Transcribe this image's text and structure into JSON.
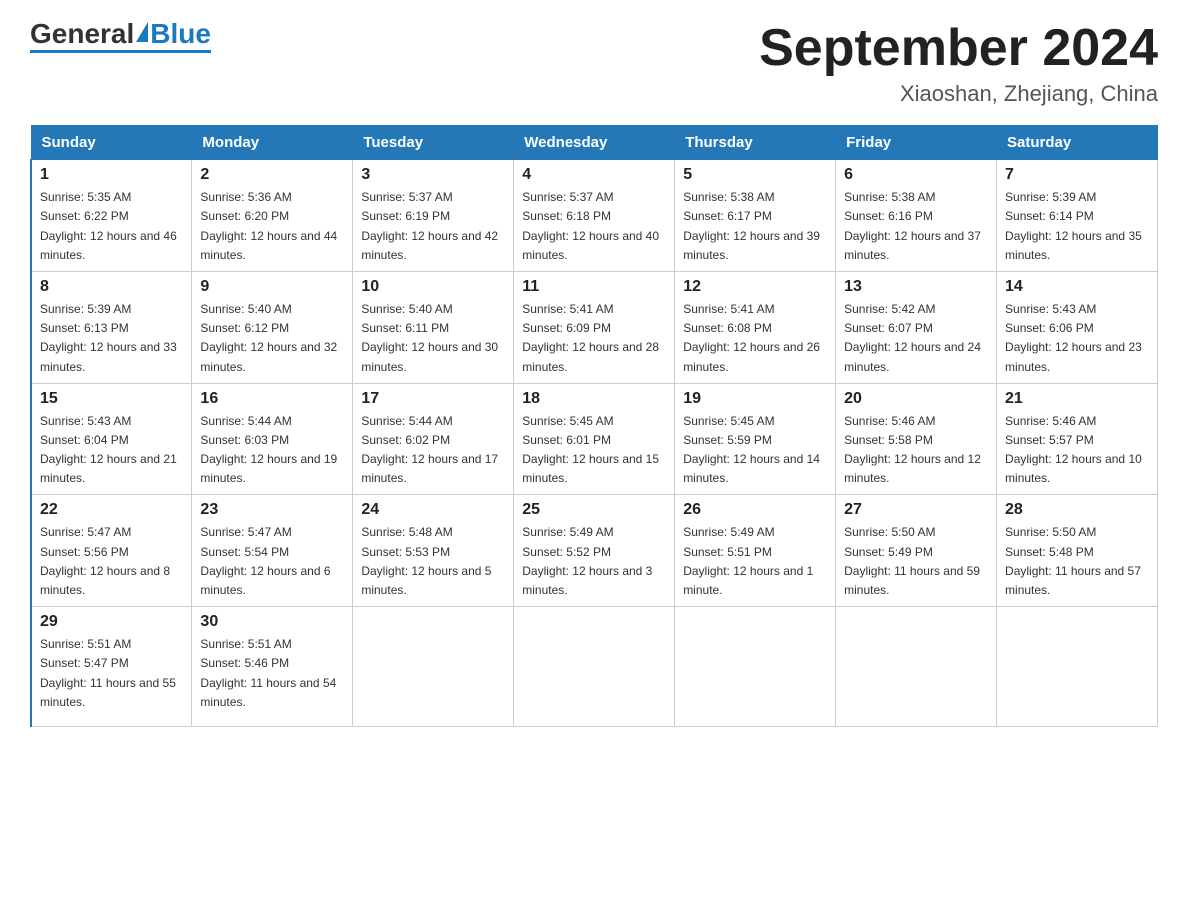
{
  "header": {
    "logo_general": "General",
    "logo_blue": "Blue",
    "month_title": "September 2024",
    "location": "Xiaoshan, Zhejiang, China"
  },
  "days_of_week": [
    "Sunday",
    "Monday",
    "Tuesday",
    "Wednesday",
    "Thursday",
    "Friday",
    "Saturday"
  ],
  "weeks": [
    [
      {
        "day": "1",
        "sunrise": "5:35 AM",
        "sunset": "6:22 PM",
        "daylight": "12 hours and 46 minutes."
      },
      {
        "day": "2",
        "sunrise": "5:36 AM",
        "sunset": "6:20 PM",
        "daylight": "12 hours and 44 minutes."
      },
      {
        "day": "3",
        "sunrise": "5:37 AM",
        "sunset": "6:19 PM",
        "daylight": "12 hours and 42 minutes."
      },
      {
        "day": "4",
        "sunrise": "5:37 AM",
        "sunset": "6:18 PM",
        "daylight": "12 hours and 40 minutes."
      },
      {
        "day": "5",
        "sunrise": "5:38 AM",
        "sunset": "6:17 PM",
        "daylight": "12 hours and 39 minutes."
      },
      {
        "day": "6",
        "sunrise": "5:38 AM",
        "sunset": "6:16 PM",
        "daylight": "12 hours and 37 minutes."
      },
      {
        "day": "7",
        "sunrise": "5:39 AM",
        "sunset": "6:14 PM",
        "daylight": "12 hours and 35 minutes."
      }
    ],
    [
      {
        "day": "8",
        "sunrise": "5:39 AM",
        "sunset": "6:13 PM",
        "daylight": "12 hours and 33 minutes."
      },
      {
        "day": "9",
        "sunrise": "5:40 AM",
        "sunset": "6:12 PM",
        "daylight": "12 hours and 32 minutes."
      },
      {
        "day": "10",
        "sunrise": "5:40 AM",
        "sunset": "6:11 PM",
        "daylight": "12 hours and 30 minutes."
      },
      {
        "day": "11",
        "sunrise": "5:41 AM",
        "sunset": "6:09 PM",
        "daylight": "12 hours and 28 minutes."
      },
      {
        "day": "12",
        "sunrise": "5:41 AM",
        "sunset": "6:08 PM",
        "daylight": "12 hours and 26 minutes."
      },
      {
        "day": "13",
        "sunrise": "5:42 AM",
        "sunset": "6:07 PM",
        "daylight": "12 hours and 24 minutes."
      },
      {
        "day": "14",
        "sunrise": "5:43 AM",
        "sunset": "6:06 PM",
        "daylight": "12 hours and 23 minutes."
      }
    ],
    [
      {
        "day": "15",
        "sunrise": "5:43 AM",
        "sunset": "6:04 PM",
        "daylight": "12 hours and 21 minutes."
      },
      {
        "day": "16",
        "sunrise": "5:44 AM",
        "sunset": "6:03 PM",
        "daylight": "12 hours and 19 minutes."
      },
      {
        "day": "17",
        "sunrise": "5:44 AM",
        "sunset": "6:02 PM",
        "daylight": "12 hours and 17 minutes."
      },
      {
        "day": "18",
        "sunrise": "5:45 AM",
        "sunset": "6:01 PM",
        "daylight": "12 hours and 15 minutes."
      },
      {
        "day": "19",
        "sunrise": "5:45 AM",
        "sunset": "5:59 PM",
        "daylight": "12 hours and 14 minutes."
      },
      {
        "day": "20",
        "sunrise": "5:46 AM",
        "sunset": "5:58 PM",
        "daylight": "12 hours and 12 minutes."
      },
      {
        "day": "21",
        "sunrise": "5:46 AM",
        "sunset": "5:57 PM",
        "daylight": "12 hours and 10 minutes."
      }
    ],
    [
      {
        "day": "22",
        "sunrise": "5:47 AM",
        "sunset": "5:56 PM",
        "daylight": "12 hours and 8 minutes."
      },
      {
        "day": "23",
        "sunrise": "5:47 AM",
        "sunset": "5:54 PM",
        "daylight": "12 hours and 6 minutes."
      },
      {
        "day": "24",
        "sunrise": "5:48 AM",
        "sunset": "5:53 PM",
        "daylight": "12 hours and 5 minutes."
      },
      {
        "day": "25",
        "sunrise": "5:49 AM",
        "sunset": "5:52 PM",
        "daylight": "12 hours and 3 minutes."
      },
      {
        "day": "26",
        "sunrise": "5:49 AM",
        "sunset": "5:51 PM",
        "daylight": "12 hours and 1 minute."
      },
      {
        "day": "27",
        "sunrise": "5:50 AM",
        "sunset": "5:49 PM",
        "daylight": "11 hours and 59 minutes."
      },
      {
        "day": "28",
        "sunrise": "5:50 AM",
        "sunset": "5:48 PM",
        "daylight": "11 hours and 57 minutes."
      }
    ],
    [
      {
        "day": "29",
        "sunrise": "5:51 AM",
        "sunset": "5:47 PM",
        "daylight": "11 hours and 55 minutes."
      },
      {
        "day": "30",
        "sunrise": "5:51 AM",
        "sunset": "5:46 PM",
        "daylight": "11 hours and 54 minutes."
      },
      null,
      null,
      null,
      null,
      null
    ]
  ],
  "labels": {
    "sunrise": "Sunrise:",
    "sunset": "Sunset:",
    "daylight": "Daylight:"
  }
}
